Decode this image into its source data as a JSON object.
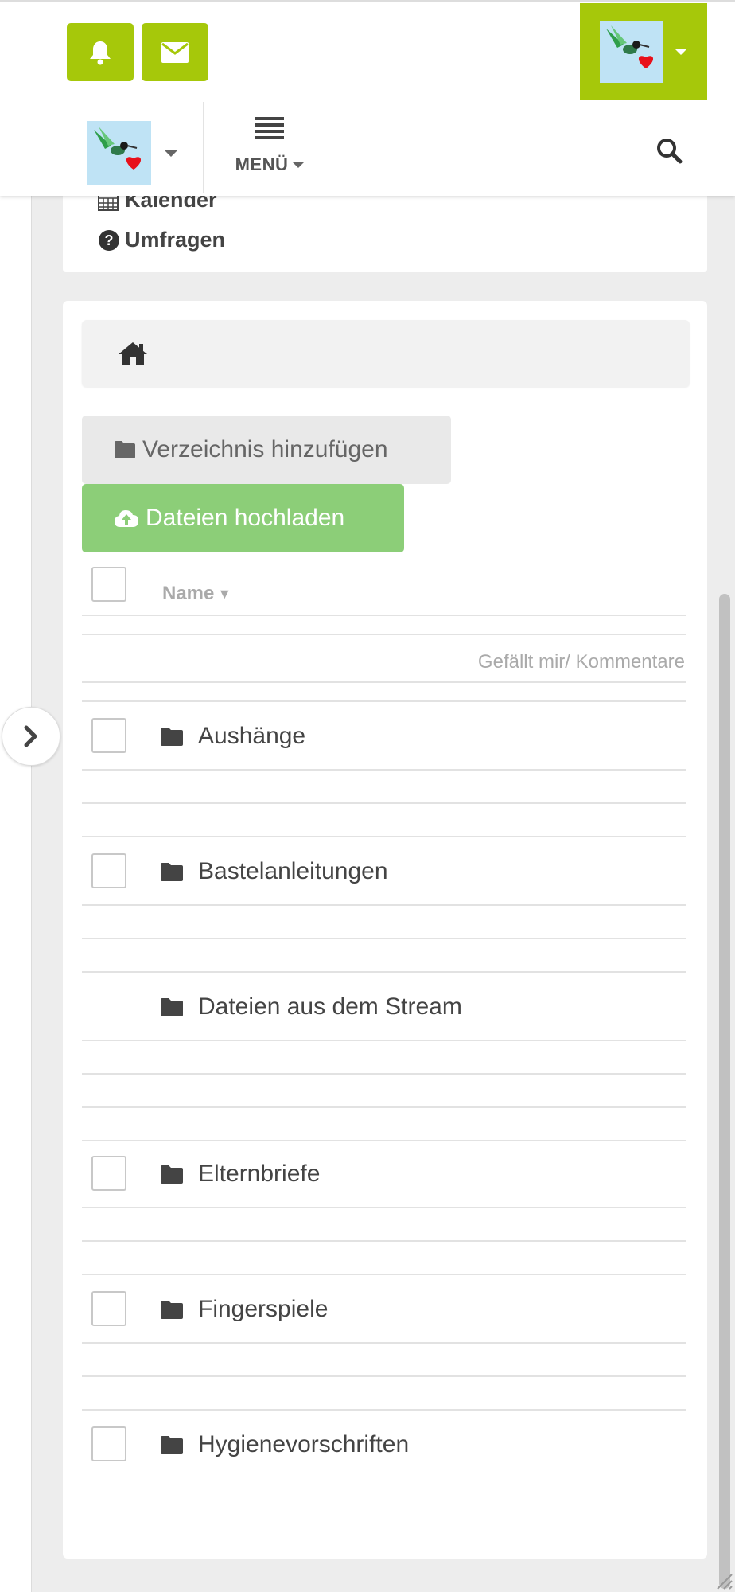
{
  "header": {
    "notifications_icon": "bell-icon",
    "messages_icon": "envelope-icon",
    "profile_avatar": "hummingbird-heart-avatar",
    "space_avatar": "hummingbird-heart-avatar",
    "menu_label": "MENÜ",
    "search_icon": "search-icon",
    "accent_color": "#a6c80a"
  },
  "menu_panel": {
    "items": [
      {
        "label": "Kalender",
        "icon": "calendar-icon"
      },
      {
        "label": "Umfragen",
        "icon": "question-circle-icon"
      }
    ]
  },
  "files": {
    "breadcrumb_icon": "home-icon",
    "add_directory_label": "Verzeichnis hinzufügen",
    "upload_label": "Dateien hochladen",
    "upload_color": "#8cce78",
    "column_name": "Name",
    "column_likes": "Gefällt mir/ Kommentare",
    "rows": [
      {
        "name": "Aushänge",
        "checkbox": true
      },
      {
        "name": "Bastelanleitungen",
        "checkbox": true
      },
      {
        "name": "Dateien aus dem Stream",
        "checkbox": false
      },
      {
        "name": "Elternbriefe",
        "checkbox": true
      },
      {
        "name": "Fingerspiele",
        "checkbox": true
      },
      {
        "name": "Hygienevorschriften",
        "checkbox": true
      }
    ]
  }
}
